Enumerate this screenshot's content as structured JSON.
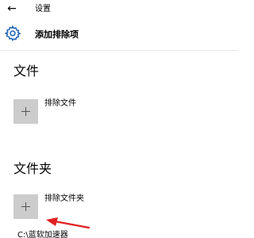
{
  "window": {
    "back_label": "←",
    "title": "设置"
  },
  "header": {
    "icon": "gear-icon",
    "title": "添加排除项"
  },
  "sections": [
    {
      "title": "文件",
      "add_label": "排除文件"
    },
    {
      "title": "文件夹",
      "add_label": "排除文件夹"
    }
  ],
  "list": {
    "partial_item": "C:\\蓝软加速器"
  },
  "colors": {
    "background": "#ffffff",
    "accent": "#1a5fb4",
    "add_button": "#cccccc",
    "annotation_arrow": "#e02020"
  }
}
